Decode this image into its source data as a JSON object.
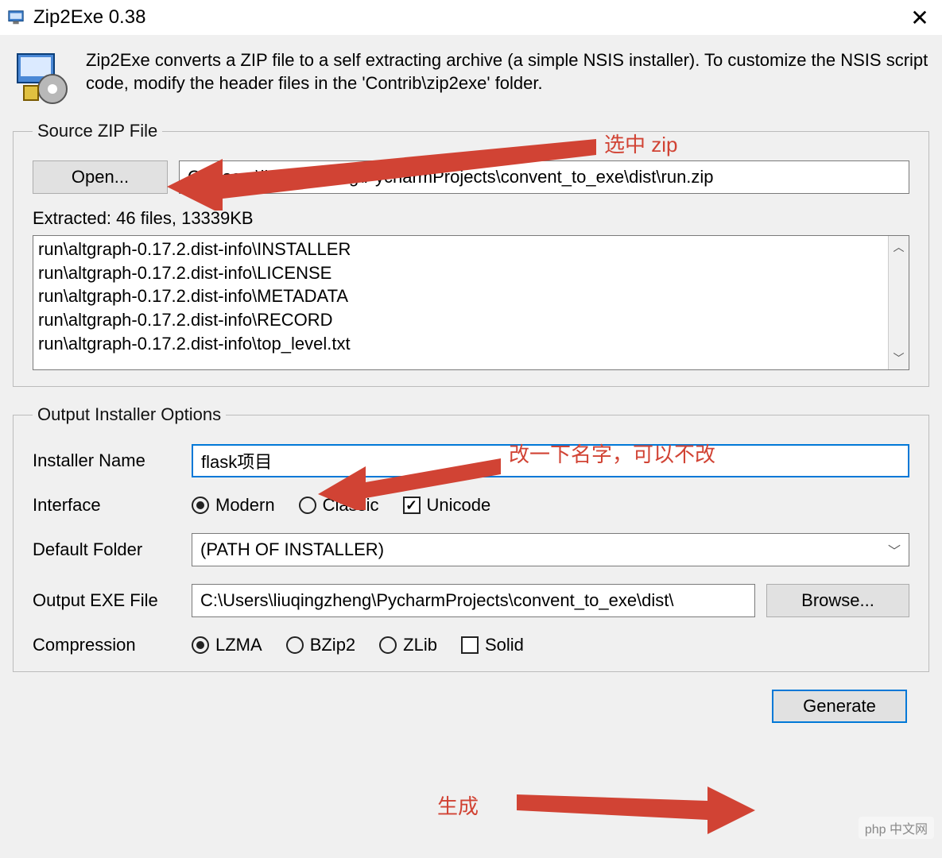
{
  "window": {
    "title": "Zip2Exe 0.38"
  },
  "intro": {
    "text": "Zip2Exe converts a ZIP file to a self extracting archive (a simple NSIS installer). To customize the NSIS script code, modify the header files in the 'Contrib\\zip2exe' folder."
  },
  "source": {
    "legend": "Source ZIP File",
    "open_button": "Open...",
    "path": "C:\\Users\\liuqingzheng\\PycharmProjects\\convent_to_exe\\dist\\run.zip",
    "extracted_label": "Extracted: 46 files, 13339KB",
    "files": [
      "run\\altgraph-0.17.2.dist-info\\INSTALLER",
      "run\\altgraph-0.17.2.dist-info\\LICENSE",
      "run\\altgraph-0.17.2.dist-info\\METADATA",
      "run\\altgraph-0.17.2.dist-info\\RECORD",
      "run\\altgraph-0.17.2.dist-info\\top_level.txt"
    ]
  },
  "output": {
    "legend": "Output Installer Options",
    "installer_name_label": "Installer Name",
    "installer_name_value": "flask项目",
    "interface_label": "Interface",
    "interface_options": {
      "modern": "Modern",
      "classic": "Classic"
    },
    "unicode_label": "Unicode",
    "default_folder_label": "Default Folder",
    "default_folder_value": "(PATH OF INSTALLER)",
    "output_exe_label": "Output EXE File",
    "output_exe_value": "C:\\Users\\liuqingzheng\\PycharmProjects\\convent_to_exe\\dist\\",
    "browse_button": "Browse...",
    "compression_label": "Compression",
    "compression_options": {
      "lzma": "LZMA",
      "bzip2": "BZip2",
      "zlib": "ZLib"
    },
    "solid_label": "Solid"
  },
  "actions": {
    "generate": "Generate"
  },
  "annotations": {
    "select_zip": "选中 zip",
    "rename": "改一下名字，可以不改",
    "generate": "生成"
  },
  "watermark": "php 中文网"
}
